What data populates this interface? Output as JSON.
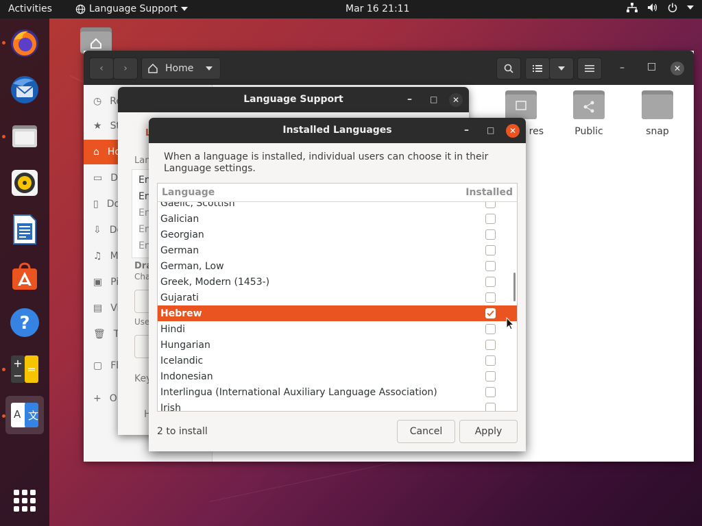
{
  "topbar": {
    "activities": "Activities",
    "app_menu": "Language Support",
    "clock": "Mar 16  21:11"
  },
  "dock": {
    "items": [
      "firefox-icon",
      "thunderbird-icon",
      "files-icon",
      "rhythmbox-icon",
      "libreoffice-writer-icon",
      "software-icon",
      "help-icon",
      "calculator-icon",
      "language-support-icon"
    ],
    "language_icon_text": [
      "A",
      "文"
    ]
  },
  "files": {
    "location": "Home",
    "sidebar": [
      "Re",
      "St",
      "Ho",
      "De",
      "Do",
      "Do",
      "M",
      "Pi",
      "Vi",
      "Tr",
      "Fl",
      "O"
    ],
    "sidebar_prefix_note": "",
    "folders": [
      "res",
      "Public",
      "snap"
    ]
  },
  "language_support": {
    "title": "Language Support",
    "tab_partial": "L",
    "label_partial": "Lan",
    "list_partial": [
      "En",
      "En",
      "En",
      "En",
      "En"
    ],
    "drag_label": "Dra",
    "drag_sub": "Cha",
    "use_label": "Use",
    "key_label": "Key",
    "help_partial": "H"
  },
  "dialog": {
    "title": "Installed Languages",
    "description": "When a language is installed, individual users can choose it in their Language settings.",
    "col_language": "Language",
    "col_installed": "Installed",
    "rows": [
      {
        "name": "Gaelic, Scottish",
        "checked": false
      },
      {
        "name": "Galician",
        "checked": false
      },
      {
        "name": "Georgian",
        "checked": false
      },
      {
        "name": "German",
        "checked": false
      },
      {
        "name": "German, Low",
        "checked": false
      },
      {
        "name": "Greek, Modern (1453-)",
        "checked": false
      },
      {
        "name": "Gujarati",
        "checked": false
      },
      {
        "name": "Hebrew",
        "checked": true
      },
      {
        "name": "Hindi",
        "checked": false
      },
      {
        "name": "Hungarian",
        "checked": false
      },
      {
        "name": "Icelandic",
        "checked": false
      },
      {
        "name": "Indonesian",
        "checked": false
      },
      {
        "name": "Interlingua (International Auxiliary Language Association)",
        "checked": false
      },
      {
        "name": "Irish",
        "checked": false
      }
    ],
    "selected_index": 7,
    "status": "2 to install",
    "cancel_label": "Cancel",
    "apply_label": "Apply"
  },
  "colors": {
    "accent": "#e95420",
    "titlebar": "#2c2c2c",
    "topbar": "#1d1d1d"
  }
}
